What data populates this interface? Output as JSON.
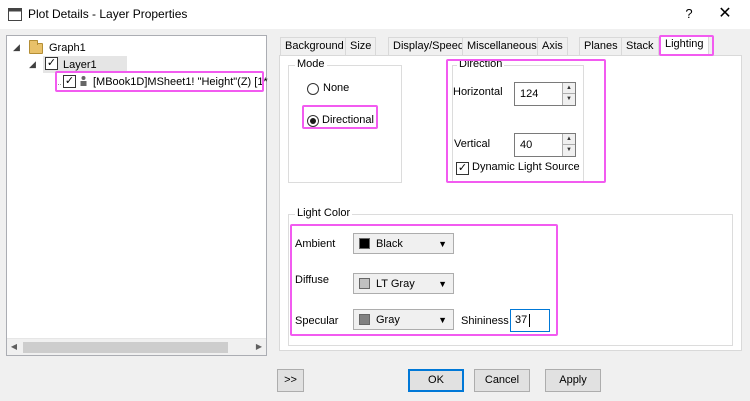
{
  "window": {
    "title": "Plot Details - Layer Properties",
    "help_label": "?",
    "close_label": "✕"
  },
  "tree": {
    "nodes": [
      {
        "label": "Graph1",
        "icon": "folder-icon"
      },
      {
        "label": "Layer1",
        "checked": true
      },
      {
        "label": "[MBook1D]MSheet1! \"Height\"(Z) [1*",
        "checked": true,
        "icon": "person-icon"
      }
    ],
    "scroll_left": "◀",
    "scroll_right": "▶"
  },
  "tabs": [
    {
      "label": "Background"
    },
    {
      "label": "Size"
    },
    {
      "label": "Display/Speed"
    },
    {
      "label": "Miscellaneous"
    },
    {
      "label": "Axis"
    },
    {
      "label": "Planes"
    },
    {
      "label": "Stack"
    },
    {
      "label": "Lighting",
      "active": true
    }
  ],
  "mode": {
    "label": "Mode",
    "options": [
      {
        "label": "None",
        "selected": false
      },
      {
        "label": "Directional",
        "selected": true
      }
    ]
  },
  "direction": {
    "label": "Direction",
    "horizontal_label": "Horizontal",
    "horizontal_value": "124",
    "vertical_label": "Vertical",
    "vertical_value": "40",
    "dynamic_label": "Dynamic Light Source",
    "dynamic_checked": true
  },
  "light_color": {
    "label": "Light Color",
    "ambient_label": "Ambient",
    "ambient_value": "Black",
    "ambient_color": "#000000",
    "diffuse_label": "Diffuse",
    "diffuse_value": "LT Gray",
    "diffuse_color": "#c0c0c0",
    "specular_label": "Specular",
    "specular_value": "Gray",
    "specular_color": "#808080",
    "shininess_label": "Shininess",
    "shininess_value": "37"
  },
  "buttons": {
    "expand": ">>",
    "ok": "OK",
    "cancel": "Cancel",
    "apply": "Apply"
  },
  "colors": {
    "highlight": "#f25bf0",
    "default_button_border": "#0078d7"
  }
}
